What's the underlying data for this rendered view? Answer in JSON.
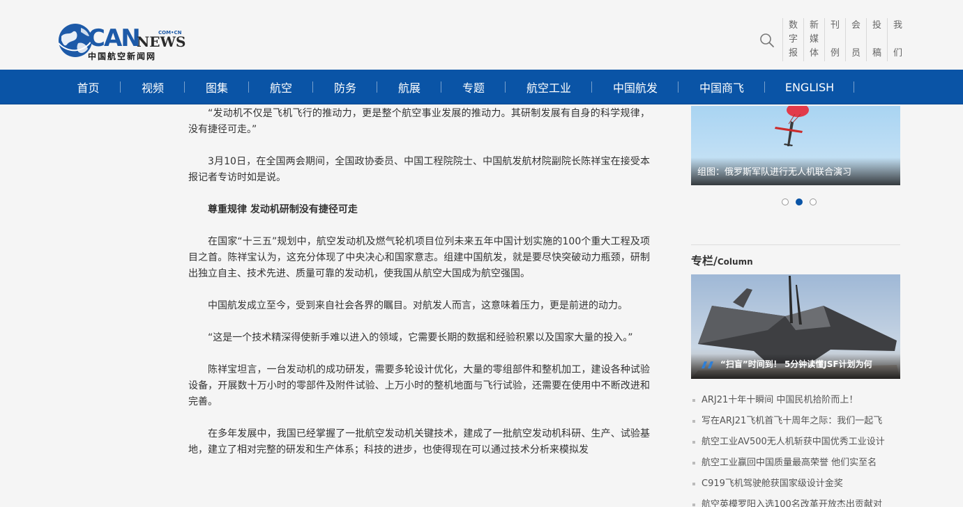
{
  "logo": {
    "brand": "CAN",
    "news": "NEWS",
    "domain": "COM•CN",
    "subtitle": "中国航空新闻网"
  },
  "header": {
    "search_icon": "search-icon",
    "links": [
      {
        "chars": [
          "数",
          "字",
          "报"
        ]
      },
      {
        "chars": [
          "新",
          "媒",
          "体"
        ]
      },
      {
        "chars": [
          "刊",
          "例"
        ]
      },
      {
        "chars": [
          "会",
          "员"
        ]
      },
      {
        "chars": [
          "投",
          "稿"
        ]
      },
      {
        "chars": [
          "我",
          "们"
        ]
      }
    ]
  },
  "nav": {
    "items": [
      "首页",
      "视频",
      "图集",
      "航空",
      "防务",
      "航展",
      "专题",
      "航空工业",
      "中国航发",
      "中国商飞",
      "ENGLISH"
    ]
  },
  "article": {
    "paragraphs": [
      "“发动机不仅是飞机飞行的推动力，更是整个航空事业发展的推动力。其研制发展有自身的科学规律，没有捷径可走。”",
      "3月10日，在全国两会期间，全国政协委员、中国工程院院士、中国航发航材院副院长陈祥宝在接受本报记者专访时如是说。",
      "尊重规律 发动机研制没有捷径可走",
      "在国家“十三五”规划中，航空发动机及燃气轮机项目位列未来五年中国计划实施的100个重大工程及项目之首。陈祥宝认为，这充分体现了中央决心和国家意志。组建中国航发，就是要尽快突破动力瓶颈，研制出独立自主、技术先进、质量可靠的发动机，使我国从航空大国成为航空强国。",
      "中国航发成立至今，受到来自社会各界的瞩目。对航发人而言，这意味着压力，更是前进的动力。",
      "“这是一个技术精深得使新手难以进入的领域，它需要长期的数据和经验积累以及国家大量的投入。”",
      "陈祥宝坦言，一台发动机的成功研发，需要多轮设计优化，大量的零组部件和整机加工，建设各种试验设备，开展数十万小时的零部件及附件试验、上万小时的整机地面与飞行试验，还需要在使用中不断改进和完善。",
      "在多年发展中，我国已经掌握了一批航空发动机关键技术，建成了一批航空发动机科研、生产、试验基地，建立了相对完整的研发和生产体系；科技的进步，也使得现在可以通过技术分析来模拟发"
    ]
  },
  "sidebar": {
    "slider_caption": "组图：俄罗斯军队进行无人机联合演习",
    "dots": [
      false,
      true,
      false
    ],
    "column_title": "专栏/",
    "column_title_en": "Column",
    "column_caption": "“扫盲”时间到！ 5分钟读懂JSF计划为何",
    "news": [
      "ARJ21十年十瞬间 中国民机拾阶而上！",
      "写在ARJ21飞机首飞十周年之际：我们一起飞",
      "航空工业AV500无人机斩获中国优秀工业设计",
      "航空工业赢回中国质量最高荣誉 他们实至名",
      "C919飞机驾驶舱获国家级设计金奖",
      "航空英模罗阳入选100名改革开放杰出贡献对"
    ]
  },
  "colors": {
    "nav_bg": "#0a54a6",
    "brand_blue": "#1d5aa8"
  }
}
